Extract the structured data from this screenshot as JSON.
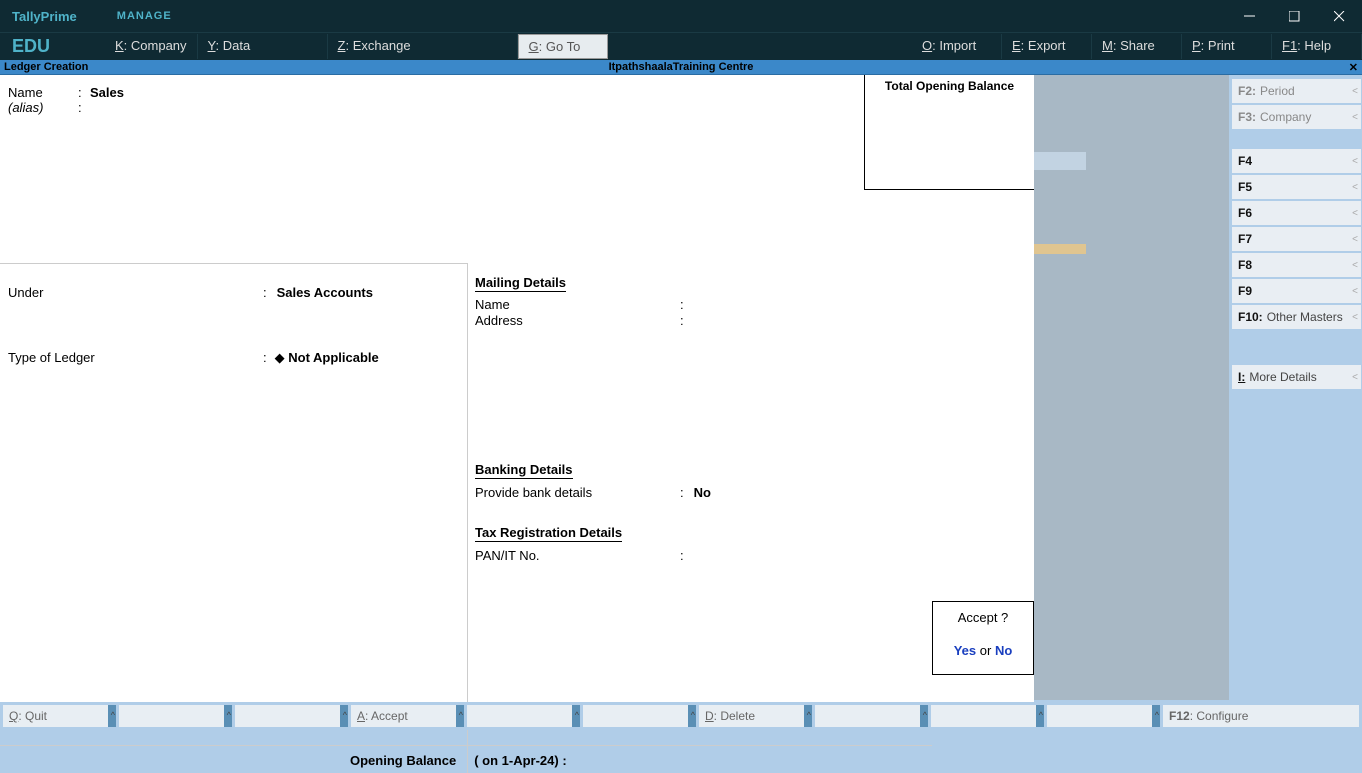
{
  "app": {
    "name": "TallyPrime",
    "edition": "EDU",
    "manage": "MANAGE"
  },
  "topmenu": {
    "company": {
      "key": "K",
      "label": ": Company"
    },
    "data": {
      "key": "Y",
      "label": ": Data"
    },
    "exchange": {
      "key": "Z",
      "label": ": Exchange"
    },
    "goto": {
      "key": "G",
      "label": ": Go To"
    },
    "import": {
      "key": "O",
      "label": ": Import"
    },
    "export": {
      "key": "E",
      "label": ": Export"
    },
    "share": {
      "key": "M",
      "label": ": Share"
    },
    "print": {
      "key": "P",
      "label": ": Print"
    },
    "help": {
      "key": "F1",
      "label": ": Help"
    }
  },
  "header": {
    "title": "Ledger Creation",
    "company": "ItpathshaalaTraining Centre",
    "close": "✕"
  },
  "form": {
    "name_label": "Name",
    "name_value": "Sales",
    "alias_label": "(alias)",
    "opbal_title": "Total Opening Balance",
    "under_label": "Under",
    "under_value": "Sales Accounts",
    "type_label": "Type of Ledger",
    "type_value": "Not Applicable",
    "mailing_header": "Mailing Details",
    "mail_name": "Name",
    "mail_address": "Address",
    "banking_header": "Banking Details",
    "bank_label": "Provide bank details",
    "bank_value": "No",
    "tax_header": "Tax Registration Details",
    "pan_label": "PAN/IT No.",
    "opbal_label": "Opening Balance",
    "opbal_date": "( on 1-Apr-24)  :"
  },
  "accept": {
    "q": "Accept ?",
    "yes": "Yes",
    "or": "or",
    "no": "No"
  },
  "side": [
    {
      "key": "F2:",
      "label": "Period",
      "disabled": true
    },
    {
      "key": "F3:",
      "label": "Company",
      "disabled": true
    },
    {
      "key": "F4",
      "label": ""
    },
    {
      "key": "F5",
      "label": ""
    },
    {
      "key": "F6",
      "label": ""
    },
    {
      "key": "F7",
      "label": ""
    },
    {
      "key": "F8",
      "label": ""
    },
    {
      "key": "F9",
      "label": ""
    },
    {
      "key": "F10:",
      "label": "Other Masters"
    },
    {
      "key": "I:",
      "label": "More Details",
      "ul": true
    }
  ],
  "bottom": {
    "quit": {
      "key": "Q",
      "label": ": Quit"
    },
    "accept": {
      "key": "A",
      "label": ": Accept"
    },
    "delete": {
      "key": "D",
      "label": ": Delete"
    },
    "configure": {
      "key": "F12",
      "label": ": Configure"
    }
  }
}
